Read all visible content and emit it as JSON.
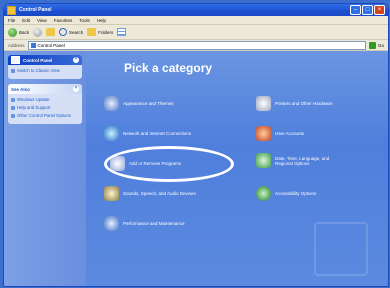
{
  "window": {
    "title": "Control Panel"
  },
  "menu": [
    "File",
    "Edit",
    "View",
    "Favorites",
    "Tools",
    "Help"
  ],
  "toolbar": {
    "back": "Back",
    "search": "Search",
    "folders": "Folders"
  },
  "address": {
    "label": "Address",
    "value": "Control Panel",
    "go": "Go"
  },
  "side": {
    "panel1": {
      "title": "Control Panel",
      "links": [
        "Switch to Classic View"
      ]
    },
    "panel2": {
      "title": "See Also",
      "links": [
        "Windows Update",
        "Help and Support",
        "Other Control Panel Options"
      ]
    }
  },
  "main": {
    "heading": "Pick a category",
    "categories": [
      {
        "label": "Appearance and Themes"
      },
      {
        "label": "Printers and Other Hardware"
      },
      {
        "label": "Network and Internet Connections"
      },
      {
        "label": "User Accounts"
      },
      {
        "label": "Add or Remove Programs"
      },
      {
        "label": "Date, Time, Language, and Regional Options"
      },
      {
        "label": "Sounds, Speech, and Audio Devices"
      },
      {
        "label": "Accessibility Options"
      },
      {
        "label": "Performance and Maintenance"
      }
    ]
  },
  "colors": {
    "title_bar": "#1c4fd0",
    "main_bg": "#5c8ae0",
    "side_bg": "#7ba0e6",
    "highlight": "#ffffff"
  }
}
